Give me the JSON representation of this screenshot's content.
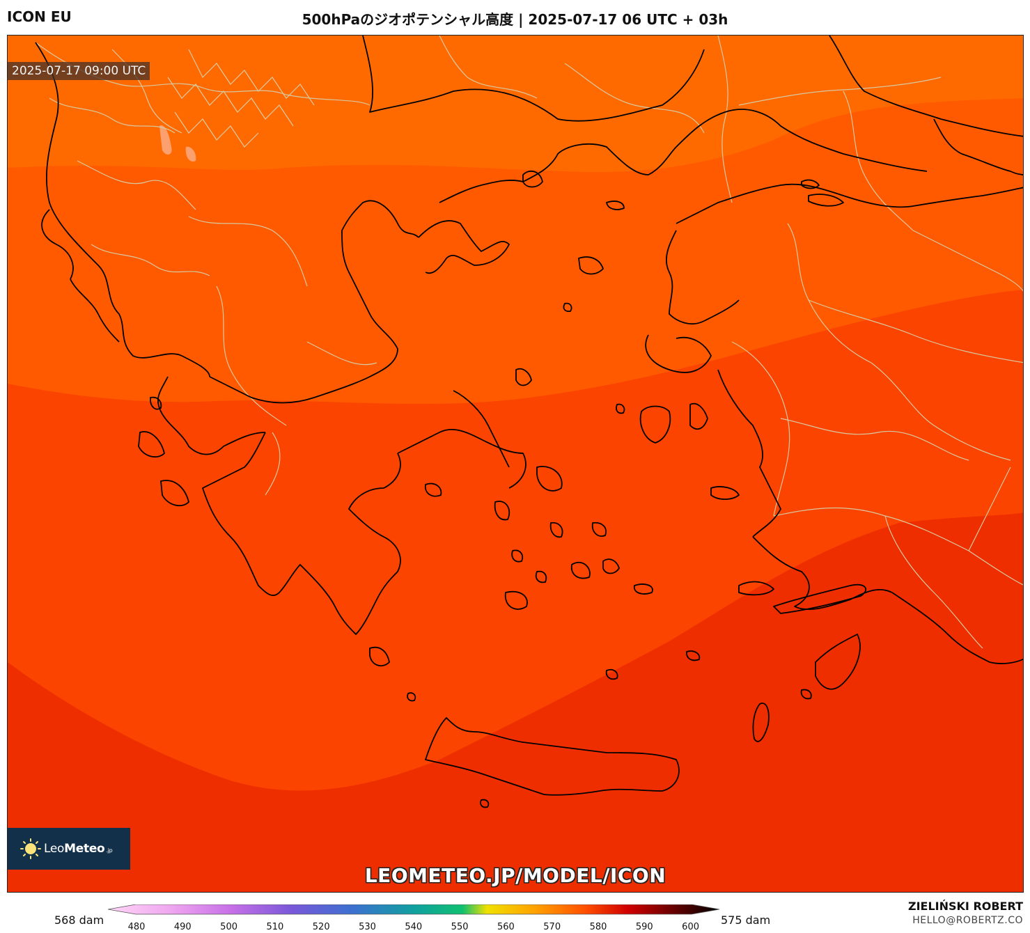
{
  "header": {
    "model": "ICON EU",
    "title": "500hPaのジオポテンシャル高度 | 2025-07-17 06 UTC + 03h"
  },
  "map": {
    "valid_time": "2025-07-17 09:00 UTC",
    "watermark": "LEOMETEO.JP/MODEL/ICON",
    "region": "Greece and Aegean Sea",
    "colors": {
      "band_575": "#ff6a00",
      "band_580": "#ff5a00",
      "band_585": "#fb4400",
      "band_590": "#ef2e00",
      "coastline": "#000000",
      "borders": "#d8c8a0"
    }
  },
  "logo": {
    "brand_light": "Leo",
    "brand_bold": "Meteo",
    "brand_suffix": ".jp",
    "icon": "sun-icon"
  },
  "colorbar": {
    "left_label": "568 dam",
    "right_label": "575 dam",
    "ticks": [
      "480",
      "490",
      "500",
      "510",
      "520",
      "530",
      "540",
      "550",
      "560",
      "570",
      "580",
      "590",
      "600"
    ]
  },
  "footer": {
    "author": "ZIELIŃSKI ROBERT",
    "email": "HELLO@ROBERTZ.CO"
  }
}
